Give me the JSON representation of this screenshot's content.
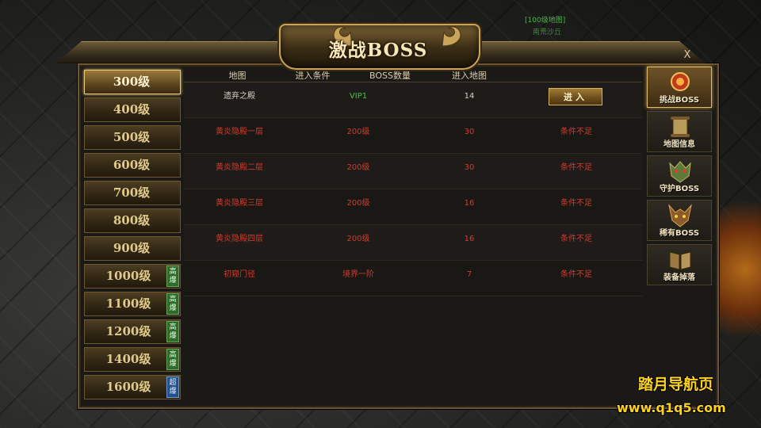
{
  "background": {
    "tag_a": "[100级地图]",
    "tag_b": "南荒沙丘"
  },
  "title": "激战BOSS",
  "close_label": "X",
  "levels": [
    {
      "label": "300级",
      "badge": "",
      "active": true
    },
    {
      "label": "400级",
      "badge": ""
    },
    {
      "label": "500级",
      "badge": ""
    },
    {
      "label": "600级",
      "badge": ""
    },
    {
      "label": "700级",
      "badge": ""
    },
    {
      "label": "800级",
      "badge": ""
    },
    {
      "label": "900级",
      "badge": ""
    },
    {
      "label": "1000级",
      "badge": "高爆"
    },
    {
      "label": "1100级",
      "badge": "高爆"
    },
    {
      "label": "1200级",
      "badge": "高爆"
    },
    {
      "label": "1400级",
      "badge": "高爆"
    },
    {
      "label": "1600级",
      "badge": "超爆"
    }
  ],
  "table": {
    "headers": [
      "地图",
      "进入条件",
      "BOSS数量",
      "进入地图"
    ],
    "rows": [
      {
        "map": "遗弃之殿",
        "condition": "VIP1",
        "count": "14",
        "action": "进入"
      },
      {
        "map": "黄炎隐殿一层",
        "condition": "200级",
        "count": "30",
        "action": "条件不足"
      },
      {
        "map": "黄炎隐殿二层",
        "condition": "200级",
        "count": "30",
        "action": "条件不足"
      },
      {
        "map": "黄炎隐殿三层",
        "condition": "200级",
        "count": "16",
        "action": "条件不足"
      },
      {
        "map": "黄炎隐殿四层",
        "condition": "200级",
        "count": "16",
        "action": "条件不足"
      },
      {
        "map": "初窥门径",
        "condition": "境界一阶",
        "count": "7",
        "action": "条件不足"
      }
    ]
  },
  "tabs": [
    {
      "label": "挑战BOSS",
      "icon": "boss-orb-icon"
    },
    {
      "label": "地图信息",
      "icon": "scroll-icon"
    },
    {
      "label": "守护BOSS",
      "icon": "guardian-mask-icon"
    },
    {
      "label": "稀有BOSS",
      "icon": "demon-mask-icon"
    },
    {
      "label": "装备掉落",
      "icon": "book-icon"
    }
  ],
  "watermark": {
    "line1": "踏月导航页",
    "line2": "www.q1q5.com"
  },
  "colors": {
    "gold": "#e9c775",
    "red_text": "#d33a2c",
    "green_text": "#46c244",
    "watermark": "#ffd21a"
  }
}
